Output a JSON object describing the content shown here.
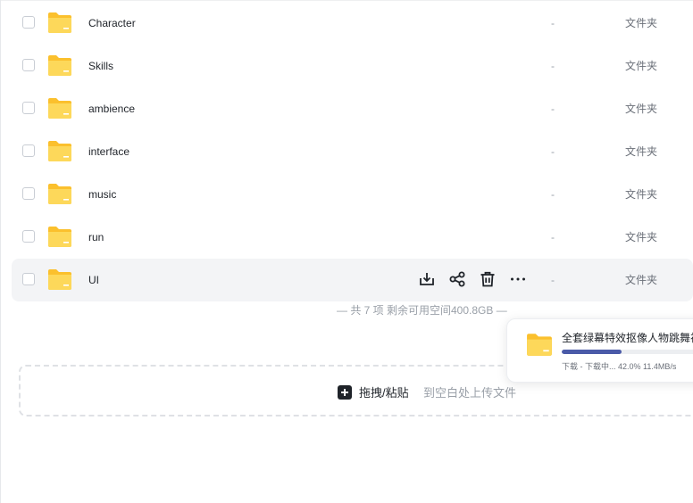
{
  "files": [
    {
      "name": "Character",
      "size": "-",
      "type": "文件夹"
    },
    {
      "name": "Skills",
      "size": "-",
      "type": "文件夹"
    },
    {
      "name": "ambience",
      "size": "-",
      "type": "文件夹"
    },
    {
      "name": "interface",
      "size": "-",
      "type": "文件夹"
    },
    {
      "name": "music",
      "size": "-",
      "type": "文件夹"
    },
    {
      "name": "run",
      "size": "-",
      "type": "文件夹"
    },
    {
      "name": "UI",
      "size": "-",
      "type": "文件夹",
      "hovered": true
    }
  ],
  "row_actions": [
    "download-icon",
    "share-icon",
    "delete-icon",
    "more-icon"
  ],
  "summary": "— 共 7 项 剩余可用空间400.8GB —",
  "upload": {
    "primary": "拖拽/粘贴",
    "secondary": "到空白处上传文件"
  },
  "task": {
    "title": "全套绿幕特效抠像人物跳舞视频",
    "progress": 0.42,
    "status": "下载 - 下载中... 42.0% 11.4MB/s"
  },
  "colors": {
    "folder": "#fbc02d",
    "folder_light": "#fdd85a",
    "progress": "#4a5aa8",
    "hover_row": "#f3f4f6"
  }
}
